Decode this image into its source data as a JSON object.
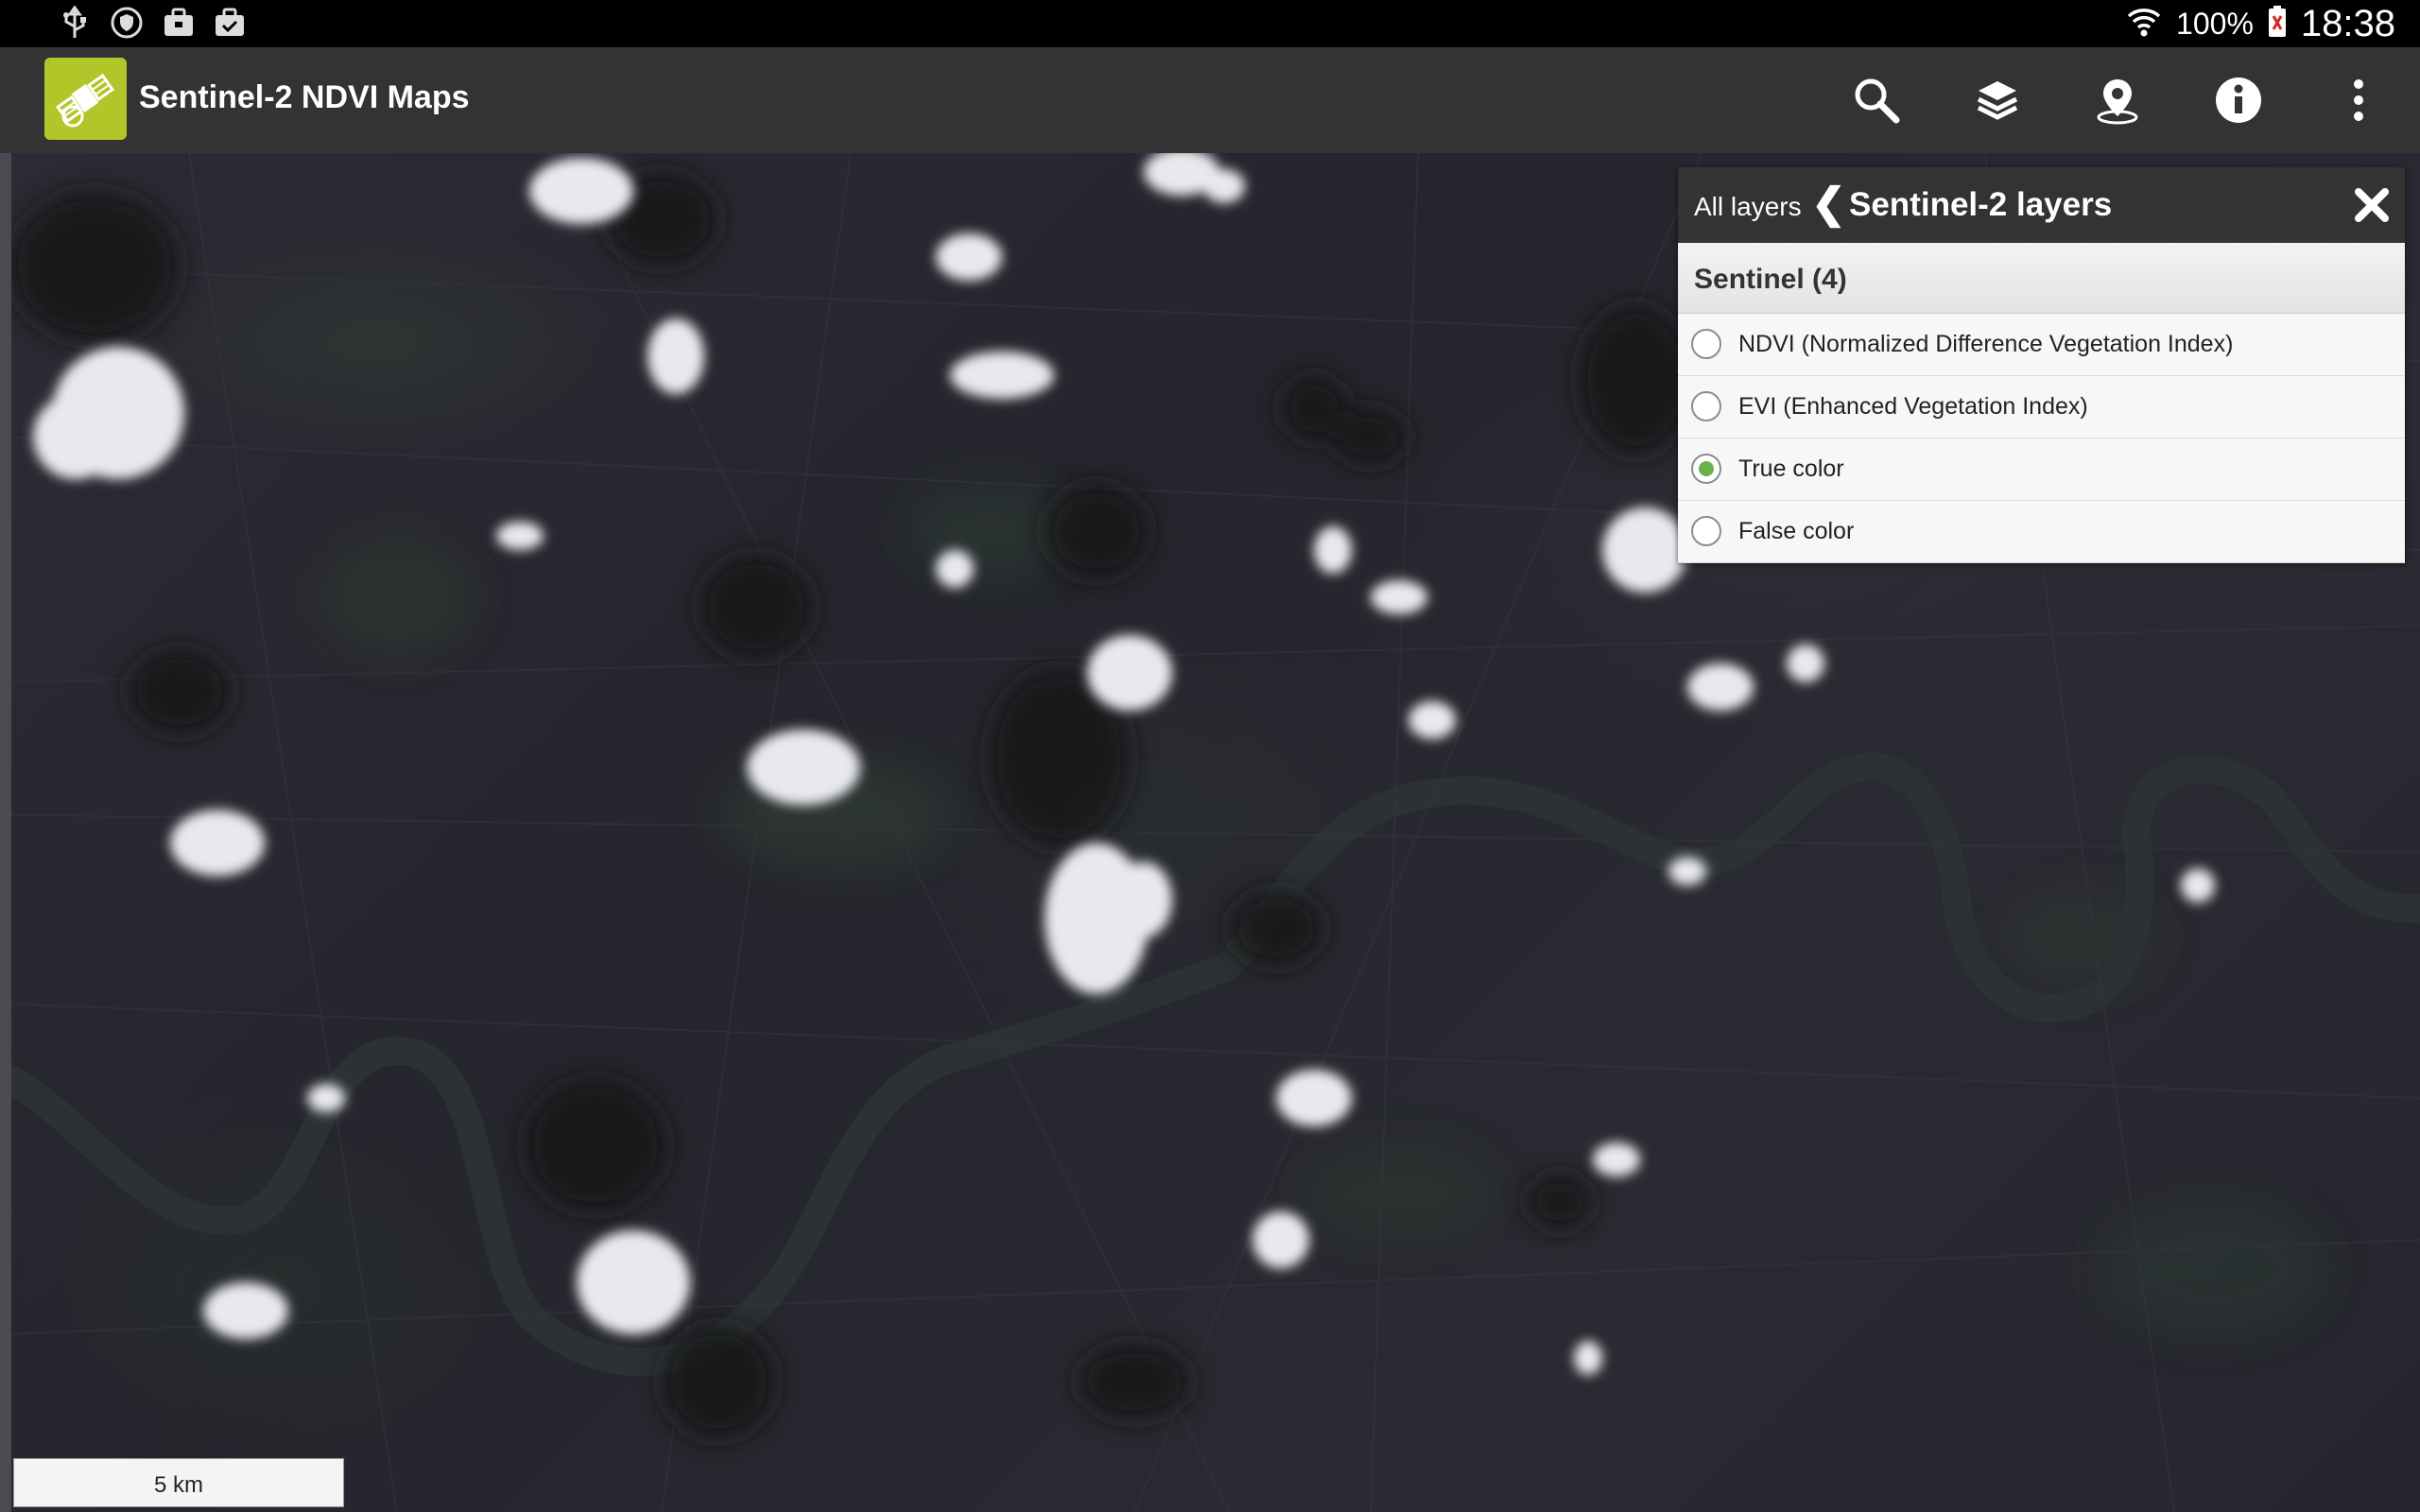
{
  "status_bar": {
    "battery_percent": "100%",
    "time": "18:38",
    "icons": [
      "usb-icon",
      "shield-icon",
      "briefcase-icon",
      "briefcase-check-icon",
      "wifi-icon",
      "battery-icon"
    ]
  },
  "action_bar": {
    "title": "Sentinel-2 NDVI Maps",
    "actions": [
      "search-icon",
      "layers-icon",
      "location-pin-icon",
      "info-icon",
      "overflow-menu-icon"
    ]
  },
  "layers_panel": {
    "breadcrumb_root": "All layers",
    "breadcrumb_separator": "❮",
    "title": "Sentinel-2 layers",
    "close_glyph": "✖",
    "group_title": "Sentinel (4)",
    "items": [
      {
        "label": "NDVI (Normalized Difference Vegetation Index)",
        "selected": false
      },
      {
        "label": "EVI (Enhanced Vegetation Index)",
        "selected": false
      },
      {
        "label": "True color",
        "selected": true
      },
      {
        "label": "False color",
        "selected": false
      }
    ]
  },
  "map": {
    "scale_label": "5 km"
  },
  "colors": {
    "action_bar": "#333333",
    "app_icon": "#b2c62a",
    "radio_selected": "#6ab04c"
  }
}
